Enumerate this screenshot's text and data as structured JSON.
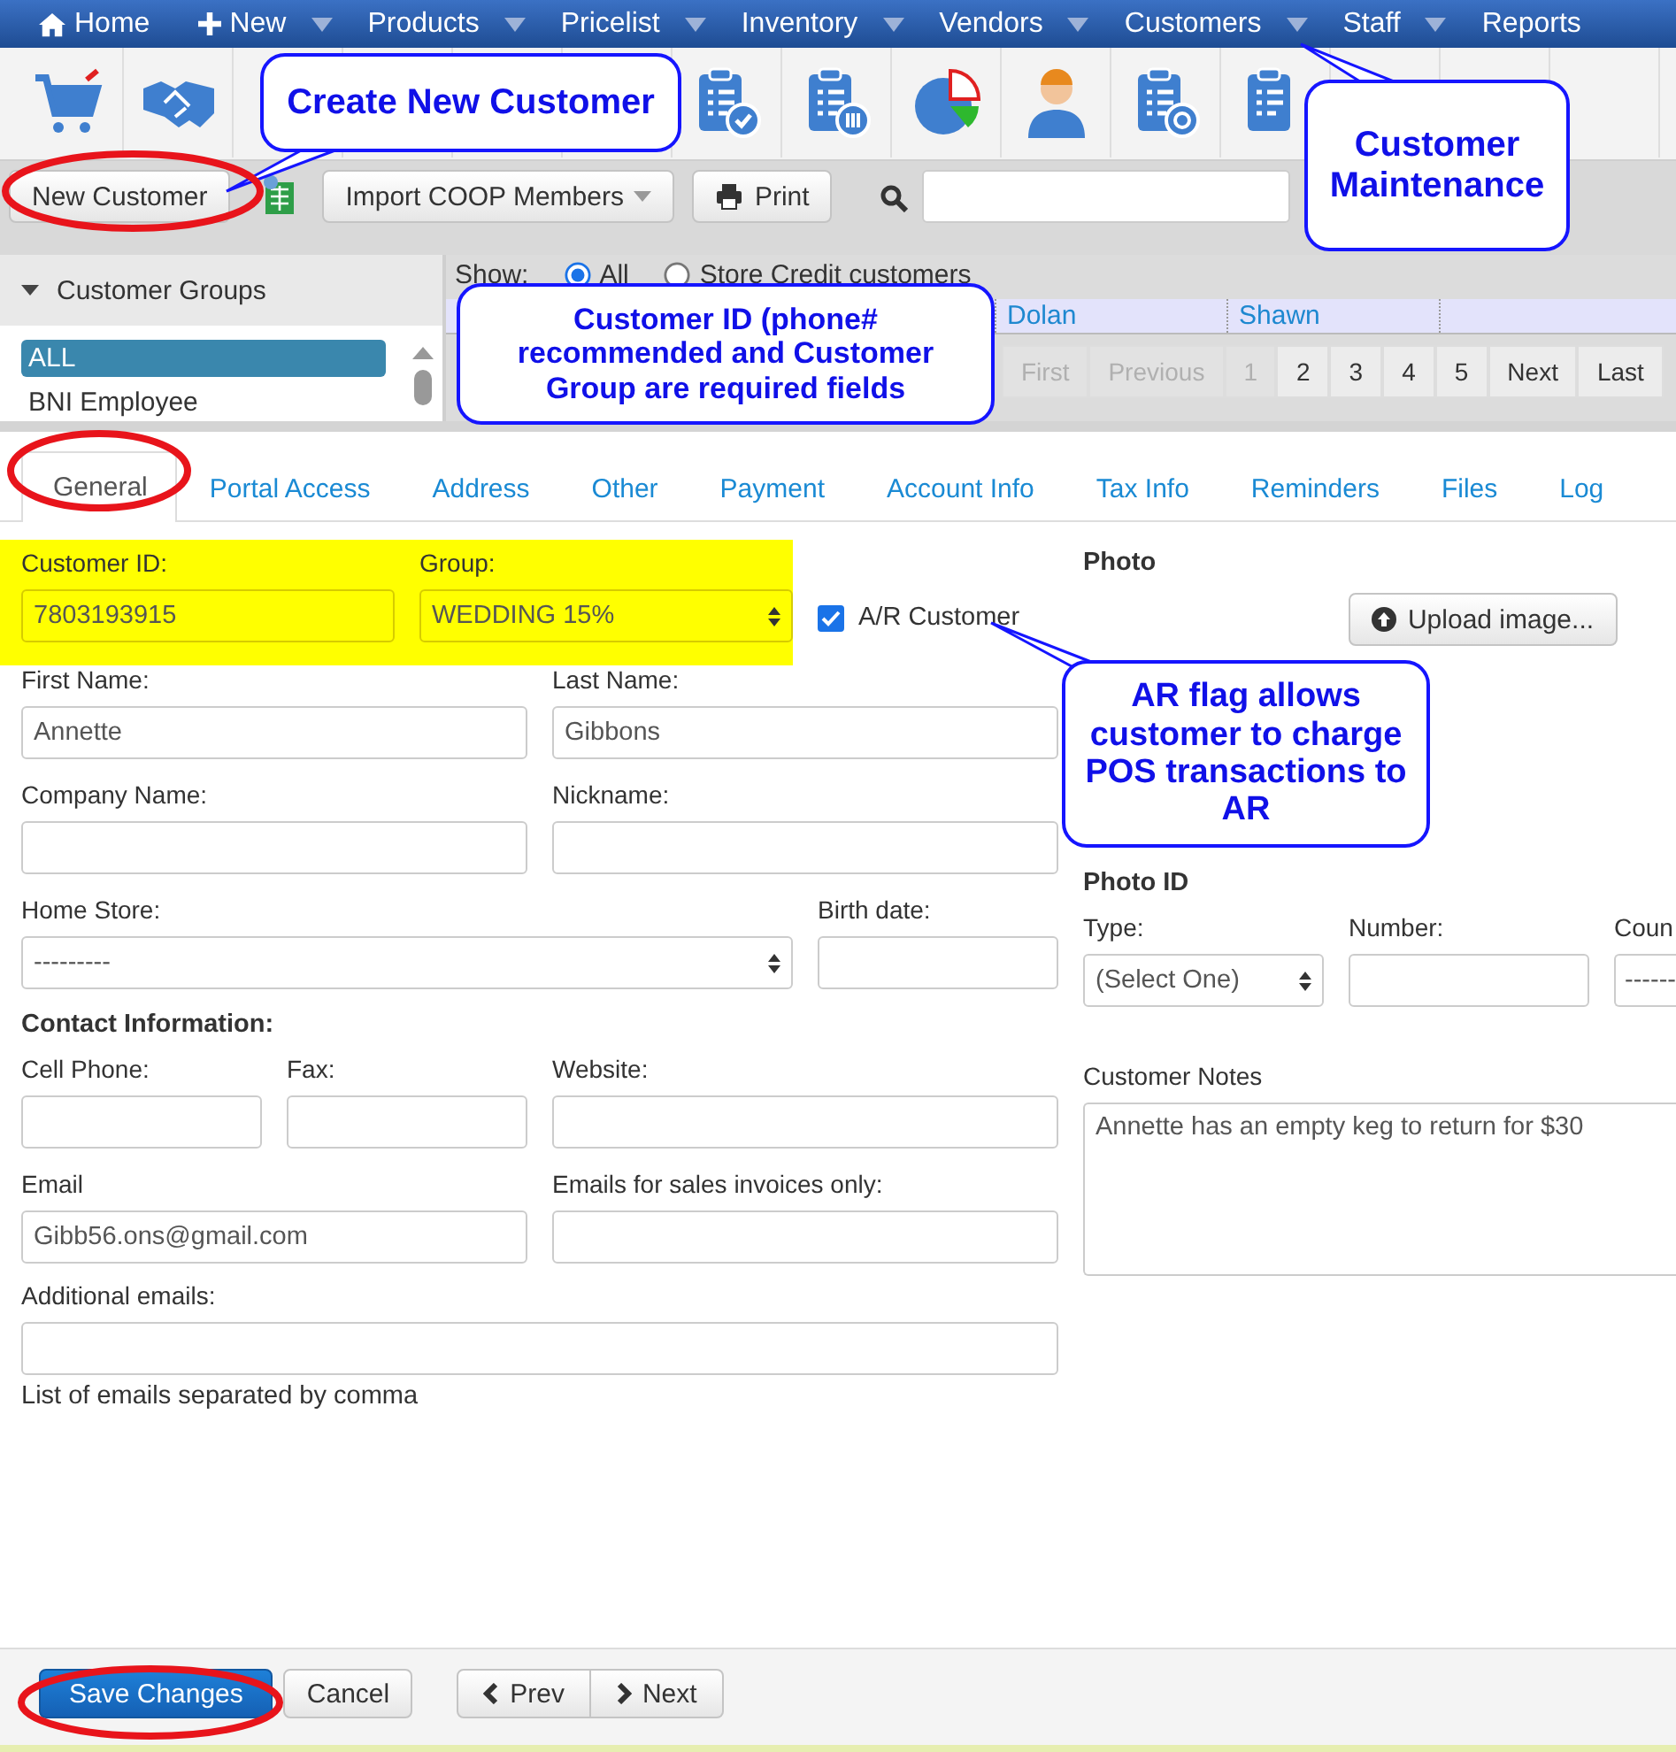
{
  "nav": [
    {
      "label": "Home",
      "dropdown": false
    },
    {
      "label": "New",
      "dropdown": true
    },
    {
      "label": "Products",
      "dropdown": true
    },
    {
      "label": "Pricelist",
      "dropdown": true
    },
    {
      "label": "Inventory",
      "dropdown": true
    },
    {
      "label": "Vendors",
      "dropdown": true
    },
    {
      "label": "Customers",
      "dropdown": true
    },
    {
      "label": "Staff",
      "dropdown": true
    },
    {
      "label": "Reports",
      "dropdown": false
    }
  ],
  "actions": {
    "new_button": "New Customer",
    "import_button": "Import COOP Members",
    "print_button": "Print"
  },
  "groups": {
    "title": "Customer Groups",
    "expanded": true,
    "items": [
      {
        "label": "ALL",
        "selected": true
      },
      {
        "label": "BNI Employee",
        "selected": false
      }
    ]
  },
  "list": {
    "show_label": "Show:",
    "filters": [
      {
        "label": "All",
        "selected": true
      },
      {
        "label": "Store Credit customers",
        "selected": false
      }
    ],
    "rows": [
      {
        "cells": [
          "Dolan",
          "Shawn"
        ]
      }
    ],
    "pager": [
      {
        "label": "First",
        "disabled": true
      },
      {
        "label": "Previous",
        "disabled": true
      },
      {
        "label": "1",
        "disabled": true
      },
      {
        "label": "2",
        "disabled": false
      },
      {
        "label": "3",
        "disabled": false
      },
      {
        "label": "4",
        "disabled": false
      },
      {
        "label": "5",
        "disabled": false
      },
      {
        "label": "Next",
        "disabled": false
      },
      {
        "label": "Last",
        "disabled": false
      }
    ]
  },
  "tabs": [
    {
      "label": "General",
      "selected": true
    },
    {
      "label": "Portal Access",
      "selected": false
    },
    {
      "label": "Address",
      "selected": false
    },
    {
      "label": "Other",
      "selected": false
    },
    {
      "label": "Payment",
      "selected": false
    },
    {
      "label": "Account Info",
      "selected": false
    },
    {
      "label": "Tax Info",
      "selected": false
    },
    {
      "label": "Reminders",
      "selected": false
    },
    {
      "label": "Files",
      "selected": false
    },
    {
      "label": "Log",
      "selected": false
    }
  ],
  "form": {
    "customer_id": {
      "label": "Customer ID:",
      "value": "7803193915"
    },
    "group": {
      "label": "Group:",
      "value": "WEDDING 15%"
    },
    "ar_customer": {
      "label": "A/R Customer",
      "checked": true
    },
    "first_name": {
      "label": "First Name:",
      "value": "Annette"
    },
    "last_name": {
      "label": "Last Name:",
      "value": "Gibbons"
    },
    "company_name": {
      "label": "Company Name:"
    },
    "nickname": {
      "label": "Nickname:"
    },
    "home_store": {
      "label": "Home Store:",
      "value": "---------"
    },
    "birth_date": {
      "label": "Birth date:"
    },
    "contact_heading": "Contact Information:",
    "cell_phone": {
      "label": "Cell Phone:"
    },
    "fax": {
      "label": "Fax:"
    },
    "website": {
      "label": "Website:"
    },
    "email": {
      "label": "Email",
      "value": "Gibb56.ons@gmail.com"
    },
    "sales_emails": {
      "label": "Emails for sales invoices only:"
    },
    "additional_emails": {
      "label": "Additional emails:",
      "help": "List of emails separated by comma"
    }
  },
  "photo": {
    "heading": "Photo",
    "upload_button": "Upload image..."
  },
  "photo_id": {
    "heading": "Photo ID",
    "type": {
      "label": "Type:",
      "value": "(Select One)"
    },
    "number": {
      "label": "Number:"
    },
    "country": {
      "label": "Coun",
      "value": "------"
    }
  },
  "notes": {
    "label": "Customer Notes",
    "value": "Annette has an empty keg to return for $30"
  },
  "footer": {
    "save_button": "Save Changes",
    "cancel_button": "Cancel",
    "prev_button": "Prev",
    "next_button": "Next"
  },
  "callouts": [
    {
      "text": "Create New Customer"
    },
    {
      "text": "Customer Maintenance"
    },
    {
      "text": "Customer ID (phone# recommended and Customer Group are required fields"
    },
    {
      "text": "AR flag allows customer to charge POS transactions to AR"
    }
  ]
}
